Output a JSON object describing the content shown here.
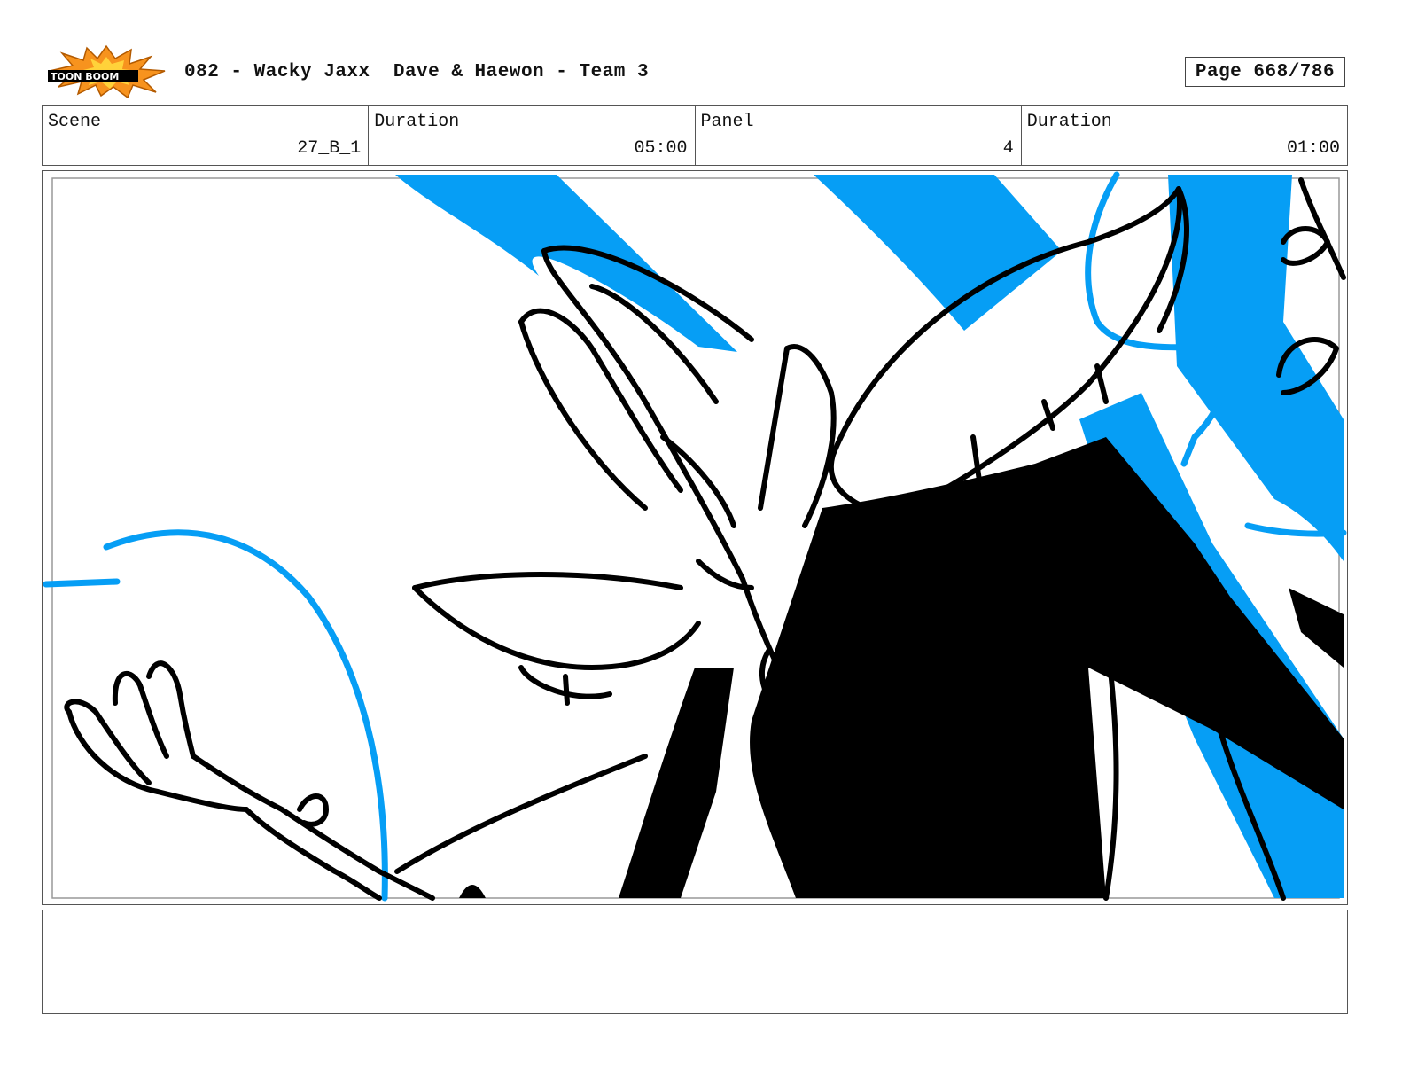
{
  "header": {
    "logo_text": "TOON BOOM",
    "title": "082 - Wacky Jaxx  Dave & Haewon - Team 3",
    "page": "Page 668/786"
  },
  "info": {
    "scene_label": "Scene",
    "scene_value": "27_B_1",
    "duration_label": "Duration",
    "duration_value": "05:00",
    "panel_label": "Panel",
    "panel_value": "4",
    "panel_duration_label": "Duration",
    "panel_duration_value": "01:00"
  },
  "colors": {
    "accent_blue": "#069ef5",
    "ink": "#000000",
    "logo_orange": "#f7931e"
  },
  "notes": {
    "text": ""
  }
}
